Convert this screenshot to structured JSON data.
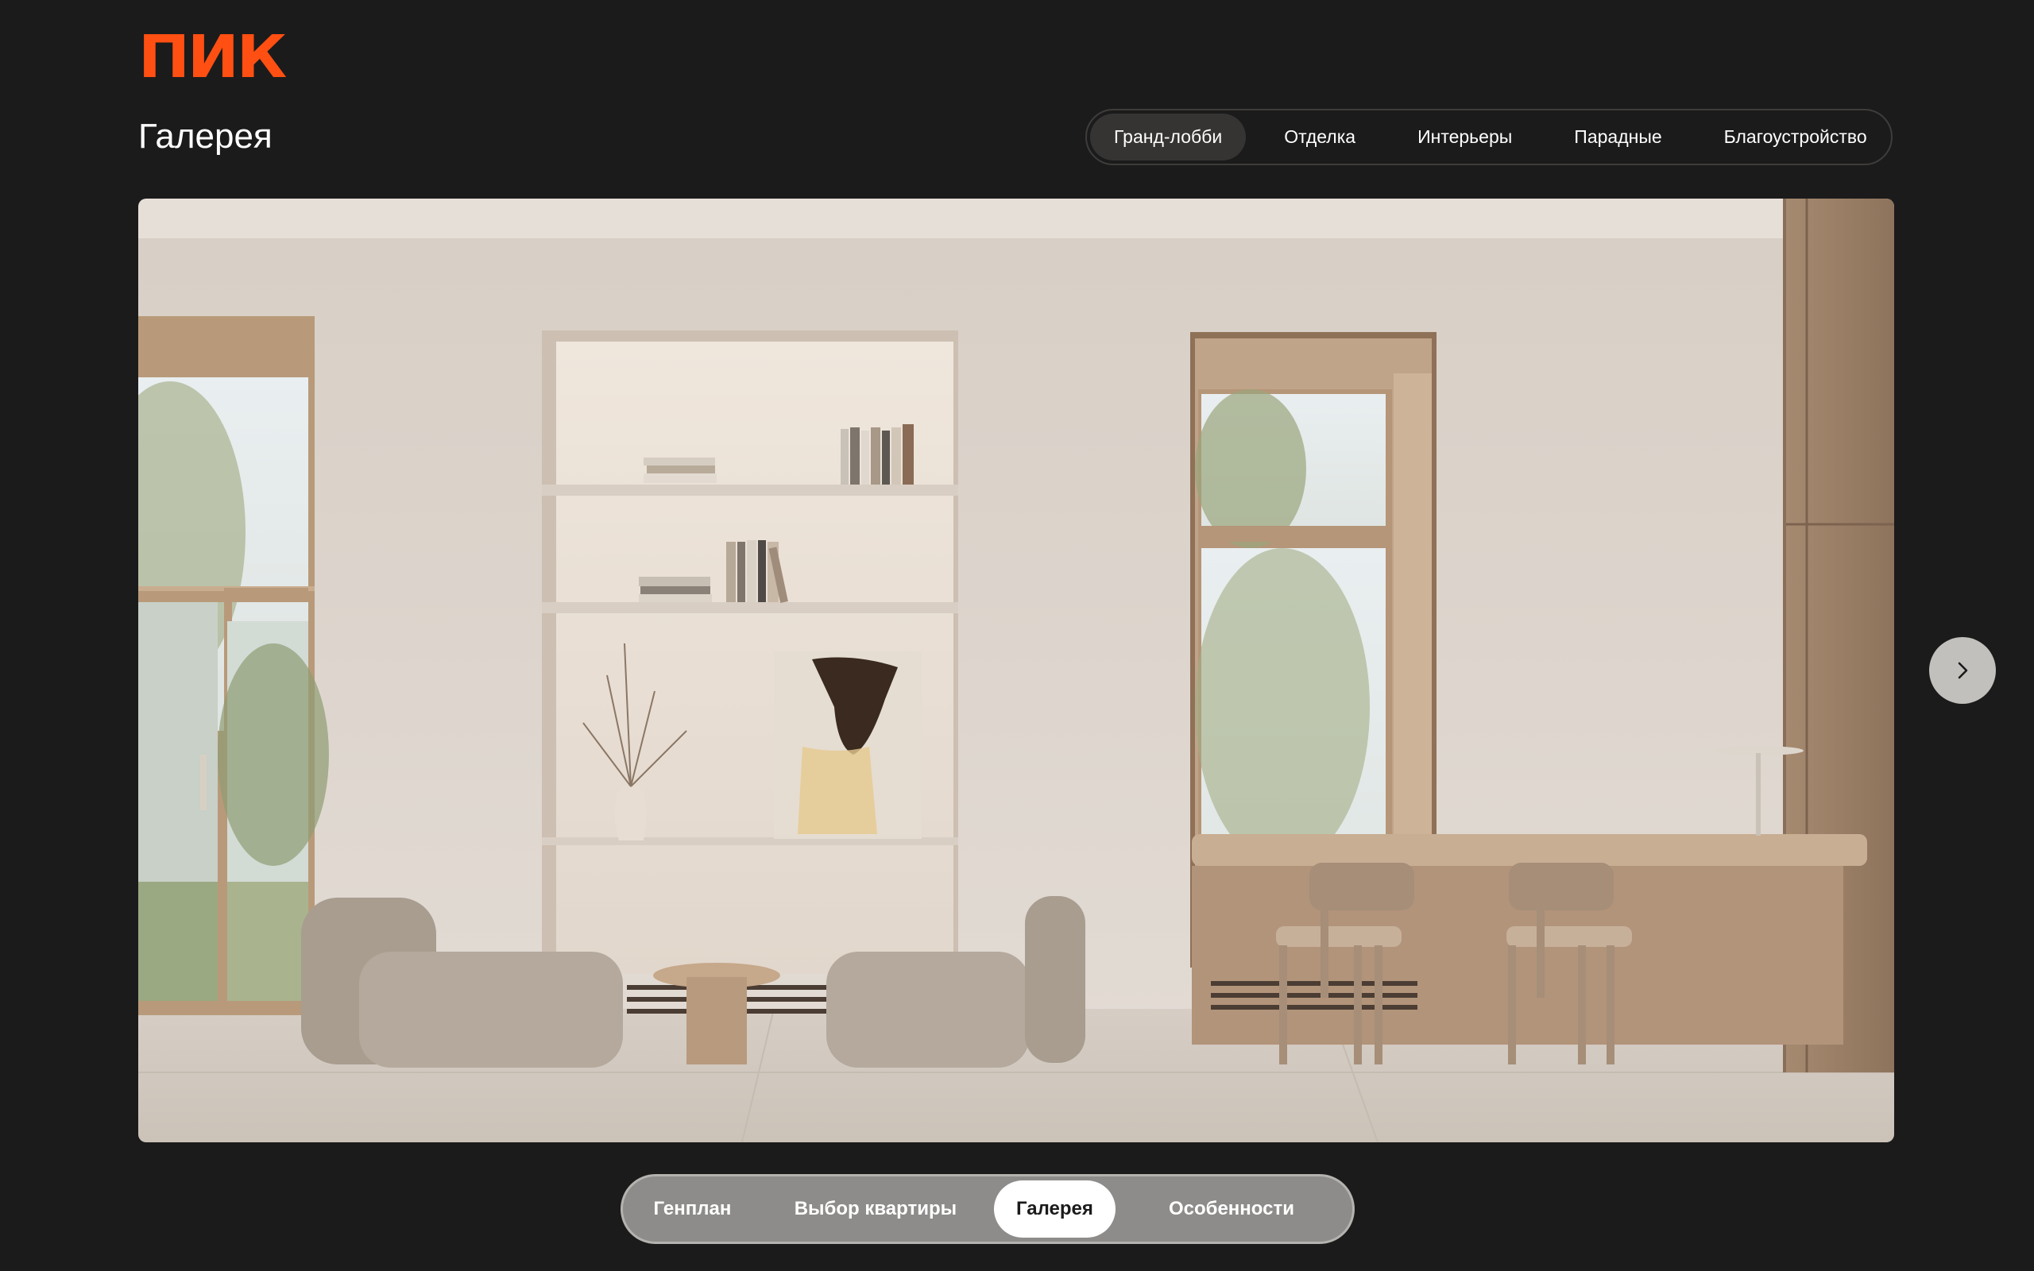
{
  "brand": {
    "logo_text": "ПИК",
    "accent_color": "#ff4f12"
  },
  "page": {
    "title": "Галерея"
  },
  "category_tabs": {
    "items": [
      {
        "label": "Гранд-лобби",
        "active": true
      },
      {
        "label": "Отделка",
        "active": false
      },
      {
        "label": "Интерьеры",
        "active": false
      },
      {
        "label": "Парадные",
        "active": false
      },
      {
        "label": "Благоустройство",
        "active": false
      }
    ]
  },
  "gallery": {
    "image_subject": "lobby-interior-render",
    "next_icon": "chevron-right-icon"
  },
  "bottom_nav": {
    "items": [
      {
        "label": "Генплан",
        "active": false
      },
      {
        "label": "Выбор квартиры",
        "active": false
      },
      {
        "label": "Галерея",
        "active": true
      },
      {
        "label": "Особенности",
        "active": false
      }
    ]
  }
}
